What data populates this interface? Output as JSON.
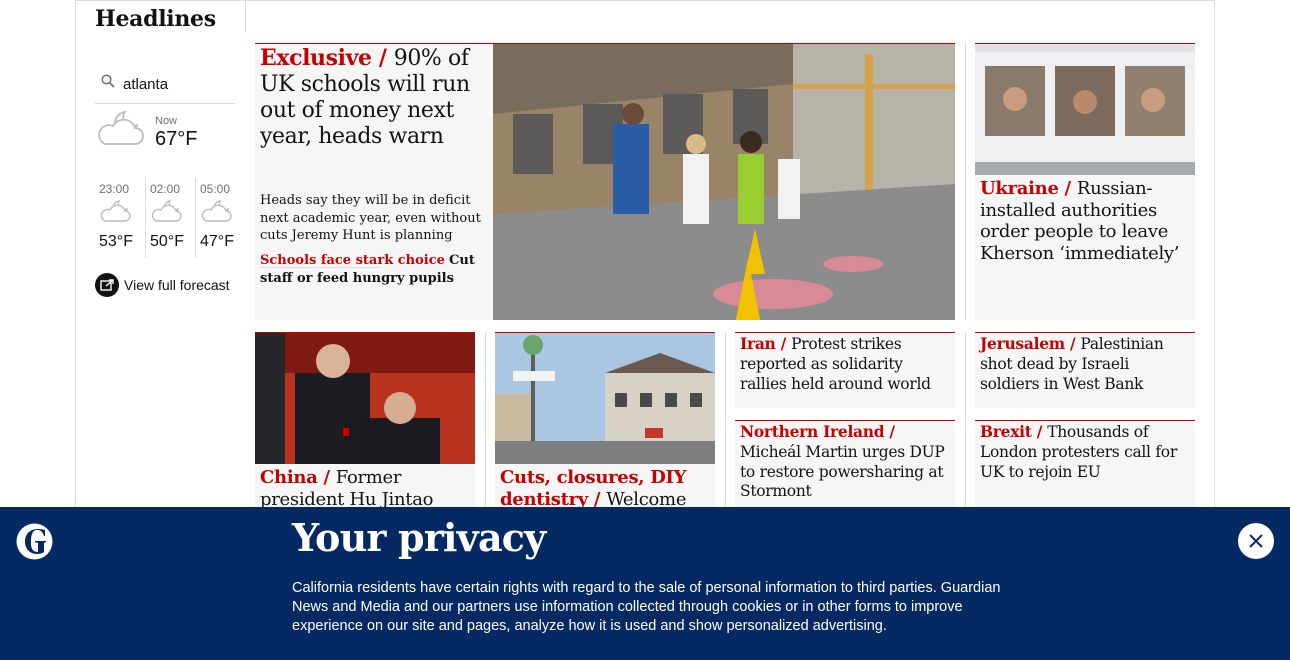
{
  "section": {
    "title": "Headlines"
  },
  "weather": {
    "location": "atlanta",
    "now": {
      "label": "Now",
      "temp": "67°F",
      "icon": "partly-cloudy-night-icon"
    },
    "hours": [
      {
        "time": "23:00",
        "temp": "53°F",
        "icon": "partly-cloudy-night-icon"
      },
      {
        "time": "02:00",
        "temp": "50°F",
        "icon": "partly-cloudy-night-icon"
      },
      {
        "time": "05:00",
        "temp": "47°F",
        "icon": "partly-cloudy-night-icon"
      }
    ],
    "forecast_link": "View full forecast"
  },
  "featured": {
    "kicker": "Exclusive",
    "headline": "90% of UK schools will run out of money next year, heads warn",
    "standfirst": "Heads say they will be in deficit next academic year, even without cuts Jeremy Hunt is planning",
    "sublink": {
      "kicker": "Schools face stark choice",
      "headline": "Cut staff or feed hungry pupils"
    }
  },
  "cards": {
    "ukraine": {
      "kicker": "Ukraine",
      "headline": "Russian-installed authorities order people to leave Kherson ‘immediately’"
    },
    "china": {
      "kicker": "China",
      "headline": "Former president Hu Jintao"
    },
    "cuts": {
      "kicker": "Cuts, closures, DIY dentistry",
      "headline": "Welcome"
    },
    "iran": {
      "kicker": "Iran",
      "headline": "Protest strikes reported as solidarity rallies held around world"
    },
    "jerusalem": {
      "kicker": "Jerusalem",
      "headline": "Palestinian shot dead by Israeli soldiers in West Bank"
    },
    "ni": {
      "kicker": "Northern Ireland",
      "headline": "Micheál Martin urges DUP to restore powersharing at Stormont"
    },
    "brexit": {
      "kicker": "Brexit",
      "headline": "Thousands of London protesters call for UK to rejoin EU"
    }
  },
  "privacy": {
    "title": "Your privacy",
    "body": "California residents have certain rights with regard to the sale of personal information to third parties. Guardian News and Media and our partners use information collected through cookies or in other forms to improve experience on our site and pages, analyze how it is used and show personalized advertising."
  },
  "colors": {
    "accent": "#c70000",
    "banner": "#052962",
    "card_bg": "#f6f6f6"
  }
}
